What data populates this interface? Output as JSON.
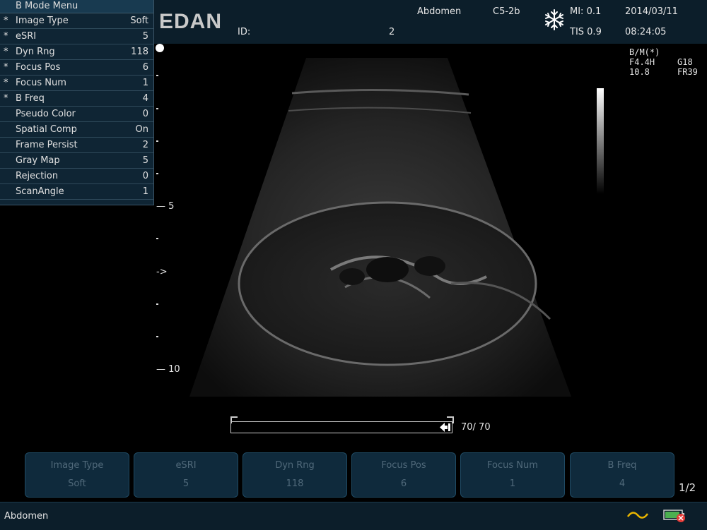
{
  "header": {
    "brand": "EDAN",
    "exam": "Abdomen",
    "probe": "C5-2b",
    "id_label": "ID:",
    "id_value": "2",
    "mi": "MI: 0.1",
    "tis": "TIS 0.9",
    "date": "2014/03/11",
    "time": "08:24:05",
    "freeze_icon": "snowflake-icon"
  },
  "menu": {
    "title": "B Mode Menu",
    "items": [
      {
        "star": "*",
        "label": "Image Type",
        "value": "Soft"
      },
      {
        "star": "*",
        "label": "eSRI",
        "value": "5"
      },
      {
        "star": "*",
        "label": "Dyn Rng",
        "value": "118"
      },
      {
        "star": "*",
        "label": "Focus Pos",
        "value": "6"
      },
      {
        "star": "*",
        "label": "Focus Num",
        "value": "1"
      },
      {
        "star": "*",
        "label": "B Freq",
        "value": "4"
      },
      {
        "star": "",
        "label": "Pseudo Color",
        "value": "0"
      },
      {
        "star": "",
        "label": "Spatial Comp",
        "value": "On"
      },
      {
        "star": "",
        "label": "Frame Persist",
        "value": "2"
      },
      {
        "star": "",
        "label": "Gray Map",
        "value": "5"
      },
      {
        "star": "",
        "label": "Rejection",
        "value": "0"
      },
      {
        "star": "",
        "label": "ScanAngle",
        "value": "1"
      }
    ]
  },
  "image_params": {
    "mode": "B/M(*)",
    "freq": "F4.4H",
    "gain": "G18",
    "depth": "10.8",
    "frame_rate": "FR39"
  },
  "depth_scale": {
    "label_5": "5",
    "label_10": "10",
    "focus_marker": "->"
  },
  "cine": {
    "count": "70/ 70",
    "icon": "cine-arrow-icon"
  },
  "softkeys": [
    {
      "label": "Image Type",
      "value": "Soft"
    },
    {
      "label": "eSRI",
      "value": "5"
    },
    {
      "label": "Dyn Rng",
      "value": "118"
    },
    {
      "label": "Focus Pos",
      "value": "6"
    },
    {
      "label": "Focus Num",
      "value": "1"
    },
    {
      "label": "B Freq",
      "value": "4"
    }
  ],
  "page_indicator": "1/2",
  "status": {
    "exam": "Abdomen",
    "icons": [
      "wave-icon",
      "battery-icon"
    ]
  },
  "colors": {
    "panel": "#0c1e2a",
    "menu": "#0f2534",
    "softkey_text": "#50697a",
    "wave": "#e8b400",
    "battery": "#4caf50"
  }
}
